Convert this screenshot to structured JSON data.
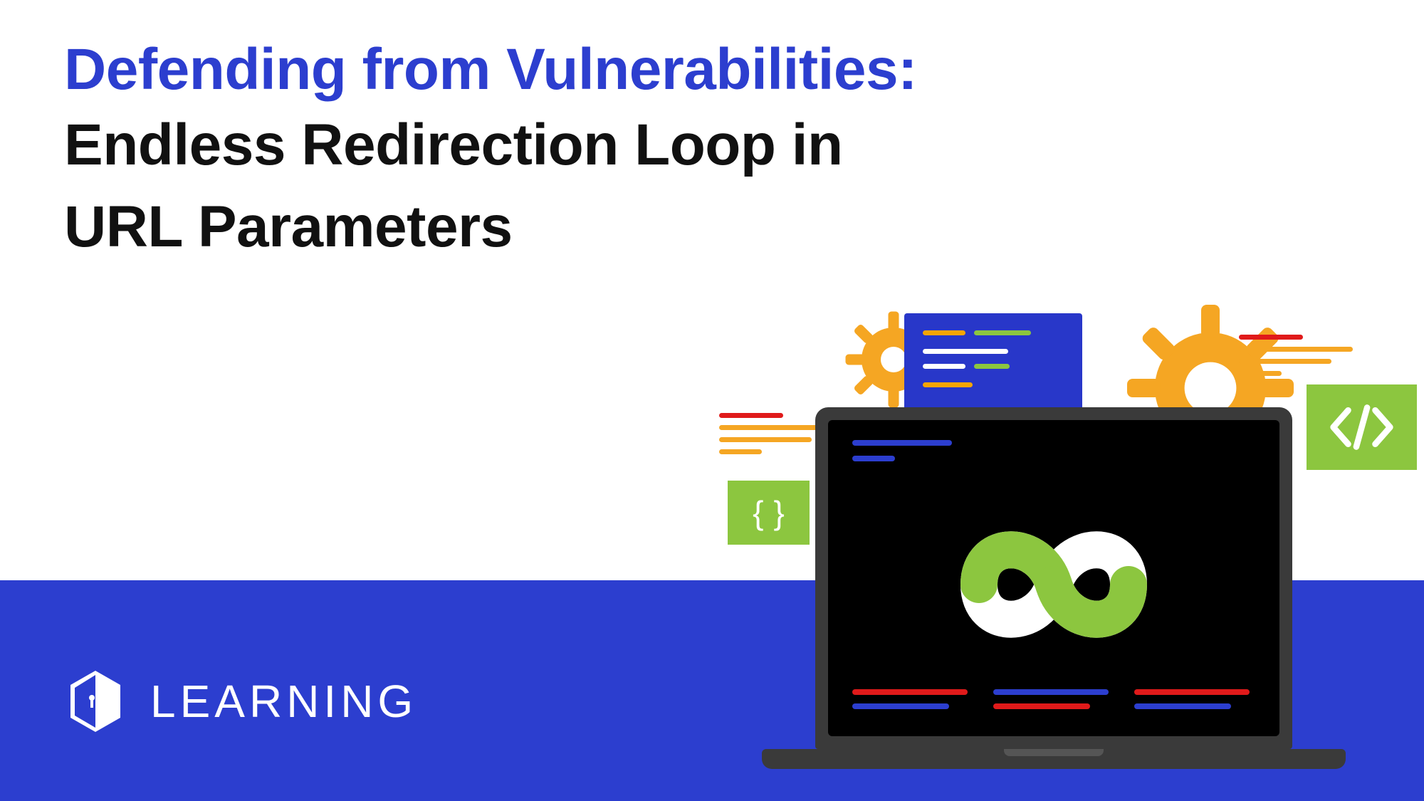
{
  "heading": {
    "kicker": "Defending from Vulnerabilities:",
    "title_line1": "Endless Redirection Loop in",
    "title_line2": "URL Parameters"
  },
  "footer": {
    "brand_text": "LEARNING"
  },
  "curly": {
    "left": "{",
    "right": "}"
  },
  "colors": {
    "accent_blue": "#2c3ecf",
    "green": "#8cc63f",
    "orange": "#f5a623",
    "red": "#e01a1a"
  }
}
